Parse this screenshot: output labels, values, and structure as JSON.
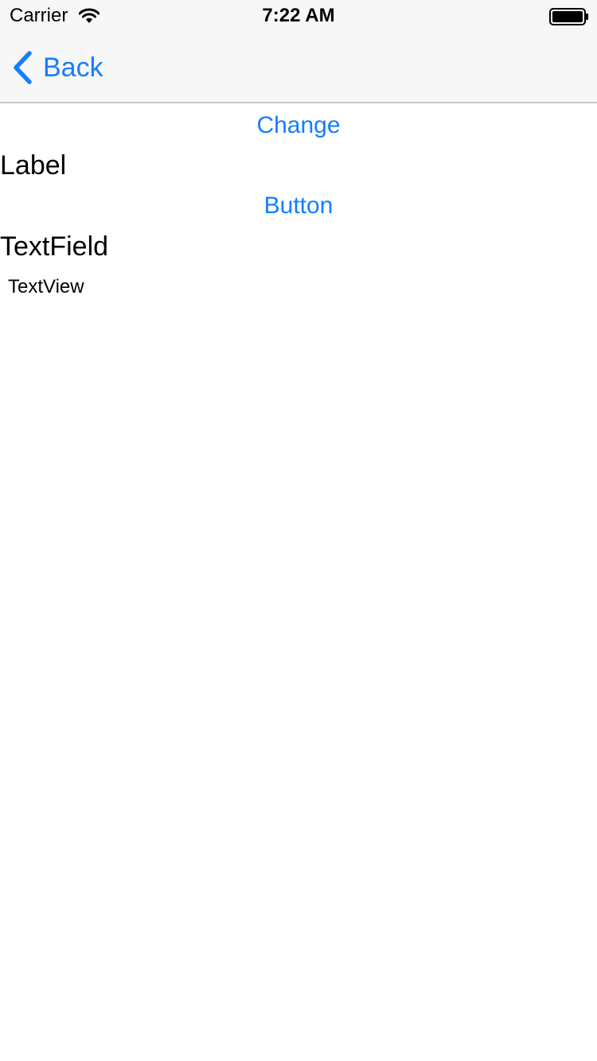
{
  "status_bar": {
    "carrier": "Carrier",
    "time": "7:22 AM",
    "wifi_icon": "wifi-icon",
    "battery_icon": "battery-full-icon"
  },
  "nav_bar": {
    "back_label": "Back",
    "back_icon": "chevron-left-icon"
  },
  "content": {
    "change_button_label": "Change",
    "label_text": "Label",
    "button_label": "Button",
    "text_field_value": "TextField",
    "text_view_value": "TextView"
  },
  "colors": {
    "accent": "#147efb",
    "nav_background": "#f7f7f7",
    "separator": "#c8c7cc",
    "text": "#000000",
    "background": "#ffffff"
  }
}
